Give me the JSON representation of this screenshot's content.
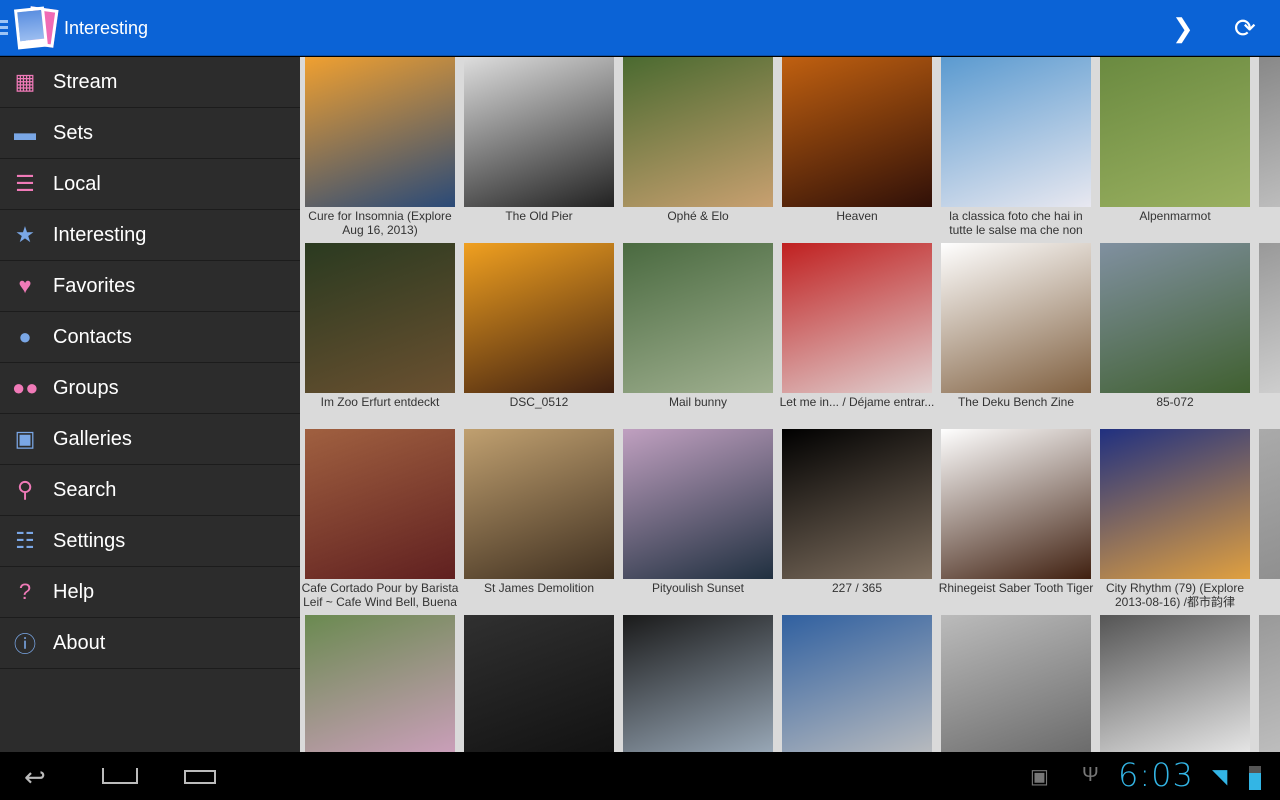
{
  "header": {
    "title": "Interesting",
    "forward_icon": "chevron-right-icon",
    "refresh_icon": "refresh-icon"
  },
  "sidebar": {
    "items": [
      {
        "label": "Stream",
        "icon": "grid-icon",
        "glyph": "▦",
        "color": "#f07ab8"
      },
      {
        "label": "Sets",
        "icon": "folder-icon",
        "glyph": "▬",
        "color": "#7aa7e6"
      },
      {
        "label": "Local",
        "icon": "list-icon",
        "glyph": "☰",
        "color": "#f07ab8"
      },
      {
        "label": "Interesting",
        "icon": "star-icon",
        "glyph": "★",
        "color": "#7aa7e6"
      },
      {
        "label": "Favorites",
        "icon": "heart-icon",
        "glyph": "♥",
        "color": "#f07ab8"
      },
      {
        "label": "Contacts",
        "icon": "person-icon",
        "glyph": "●",
        "color": "#7aa7e6"
      },
      {
        "label": "Groups",
        "icon": "people-icon",
        "glyph": "●●",
        "color": "#f07ab8"
      },
      {
        "label": "Galleries",
        "icon": "image-icon",
        "glyph": "▣",
        "color": "#7aa7e6"
      },
      {
        "label": "Search",
        "icon": "search-icon",
        "glyph": "⚲",
        "color": "#f07ab8"
      },
      {
        "label": "Settings",
        "icon": "sliders-icon",
        "glyph": "☷",
        "color": "#7aa7e6"
      },
      {
        "label": "Help",
        "icon": "question-icon",
        "glyph": "?",
        "color": "#f07ab8"
      },
      {
        "label": "About",
        "icon": "info-icon",
        "glyph": "ⓘ",
        "color": "#7aa7e6"
      }
    ]
  },
  "photos": [
    {
      "caption": "Cure for Insomnia (Explore Aug 16, 2013)",
      "colors": [
        "#f0a030",
        "#2a4a78"
      ]
    },
    {
      "caption": "The Old Pier",
      "colors": [
        "#ddd",
        "#222"
      ]
    },
    {
      "caption": "Ophé & Elo",
      "colors": [
        "#4a6a30",
        "#c8a070"
      ]
    },
    {
      "caption": "Heaven",
      "colors": [
        "#c06010",
        "#301008"
      ]
    },
    {
      "caption": "la classica foto che hai in tutte le salse ma che non",
      "colors": [
        "#5a9ad0",
        "#e8e8f0"
      ]
    },
    {
      "caption": "Alpenmarmot",
      "colors": [
        "#6a8a40",
        "#9ab060"
      ]
    },
    {
      "caption": "",
      "colors": [
        "#888",
        "#ccc"
      ]
    },
    {
      "caption": "Im Zoo Erfurt entdeckt",
      "colors": [
        "#2a3a20",
        "#6a5030"
      ]
    },
    {
      "caption": "DSC_0512",
      "colors": [
        "#f0a020",
        "#402010"
      ]
    },
    {
      "caption": "Mail bunny",
      "colors": [
        "#4a6a40",
        "#a0b090"
      ]
    },
    {
      "caption": "Let me in... / Déjame entrar...",
      "colors": [
        "#c02020",
        "#e0d0d0"
      ]
    },
    {
      "caption": "The Deku Bench Zine",
      "colors": [
        "#fff",
        "#806040"
      ]
    },
    {
      "caption": "85-072",
      "colors": [
        "#8090a0",
        "#406030"
      ]
    },
    {
      "caption": "",
      "colors": [
        "#999",
        "#ddd"
      ]
    },
    {
      "caption": "Cafe Cortado Pour by Barista Leif ~ Cafe Wind Bell, Buena",
      "colors": [
        "#a06040",
        "#602020"
      ]
    },
    {
      "caption": "St James Demolition",
      "colors": [
        "#c0a070",
        "#403020"
      ]
    },
    {
      "caption": "Pityoulish Sunset",
      "colors": [
        "#c0a0c0",
        "#203040"
      ]
    },
    {
      "caption": "227 / 365",
      "colors": [
        "#000",
        "#807060"
      ]
    },
    {
      "caption": "Rhinegeist Saber Tooth Tiger",
      "colors": [
        "#fff",
        "#402010"
      ]
    },
    {
      "caption": "City Rhythm (79) (Explore 2013-08-16) /都市韵律",
      "colors": [
        "#203080",
        "#e0a040"
      ]
    },
    {
      "caption": "",
      "colors": [
        "#aaa",
        "#888"
      ]
    },
    {
      "caption": "",
      "colors": [
        "#6a8a50",
        "#d0a0c0"
      ]
    },
    {
      "caption": "",
      "colors": [
        "#303030",
        "#101010"
      ]
    },
    {
      "caption": "",
      "colors": [
        "#1a1a1a",
        "#a0b0c0"
      ]
    },
    {
      "caption": "",
      "colors": [
        "#3060a0",
        "#c0c0c0"
      ]
    },
    {
      "caption": "",
      "colors": [
        "#bbb",
        "#666"
      ]
    },
    {
      "caption": "",
      "colors": [
        "#555",
        "#eee"
      ]
    },
    {
      "caption": "",
      "colors": [
        "#999",
        "#ccc"
      ]
    }
  ],
  "navbar": {
    "back_icon": "back-icon",
    "home_icon": "home-icon",
    "recents_icon": "recents-icon",
    "clock": "6:03",
    "android_icon": "android-debug-icon",
    "usb_icon": "usb-icon",
    "wifi_icon": "wifi-icon",
    "battery_icon": "battery-icon"
  }
}
